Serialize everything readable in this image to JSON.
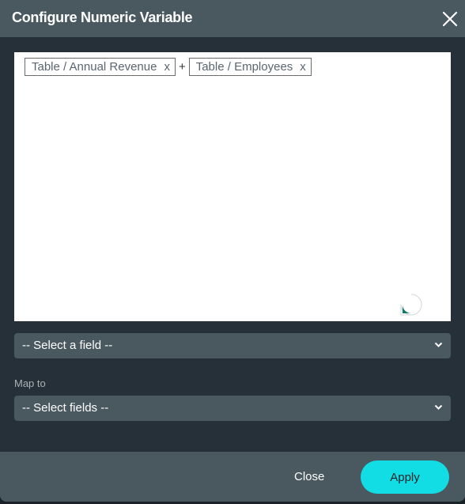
{
  "dialog": {
    "title": "Configure Numeric Variable",
    "close_icon": "close-x-icon"
  },
  "editor": {
    "tokens": [
      {
        "label": "Table / Annual Revenue",
        "remove": "x"
      },
      {
        "label": "Table / Employees",
        "remove": "x"
      }
    ],
    "operator": "+",
    "chat_icon": "chat-bubble-icon"
  },
  "field_select": {
    "value": "-- Select a field --"
  },
  "map_to": {
    "label": "Map to",
    "value": "-- Select fields --"
  },
  "footer": {
    "close_label": "Close",
    "apply_label": "Apply"
  },
  "colors": {
    "header_bg": "#4a5960",
    "body_bg": "#263038",
    "accent": "#12dce4",
    "bubble": "#0f7a63"
  }
}
